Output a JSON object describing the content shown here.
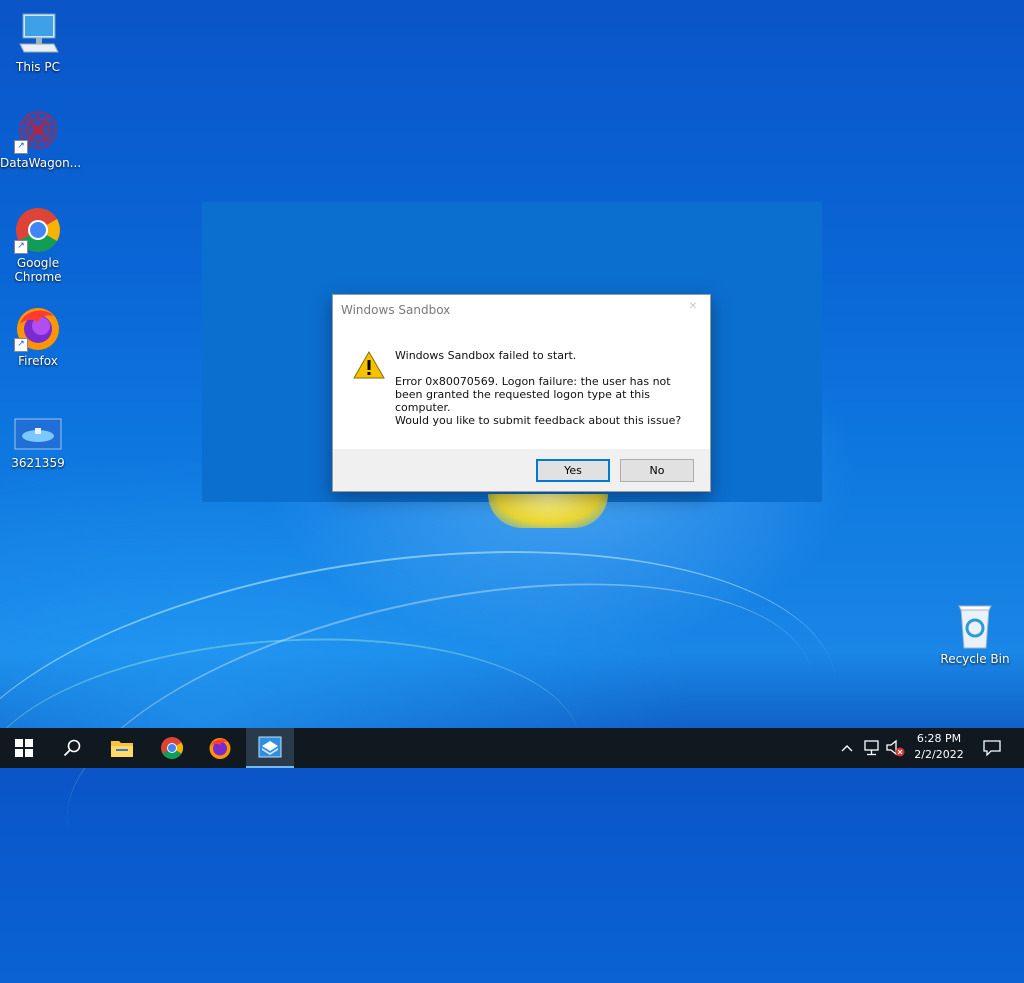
{
  "desktop": {
    "icons": [
      {
        "label": "This PC",
        "icon": "computer-icon"
      },
      {
        "label": "DataWagon...",
        "icon": "datawagon-icon"
      },
      {
        "label": "Google Chrome",
        "icon": "chrome-icon"
      },
      {
        "label": "Firefox",
        "icon": "firefox-icon"
      },
      {
        "label": "3621359",
        "icon": "image-file-icon"
      },
      {
        "label": "Recycle Bin",
        "icon": "recycle-bin-icon"
      }
    ]
  },
  "dialog": {
    "title": "Windows Sandbox",
    "heading": "Windows Sandbox failed to start.",
    "error": "Error 0x80070569. Logon failure: the user has not been granted the requested logon type at this computer.",
    "question": "Would you like to submit feedback about this issue?",
    "yes_label": "Yes",
    "no_label": "No",
    "icon": "warning-icon"
  },
  "taskbar": {
    "items": [
      "start-icon",
      "search-icon",
      "file-explorer-icon",
      "chrome-icon",
      "firefox-icon",
      "windows-sandbox-icon"
    ],
    "tray": {
      "time": "6:28 PM",
      "date": "2/2/2022"
    }
  },
  "colors": {
    "accent": "#0078d7",
    "taskbar": "#101820",
    "desktop": "#0a66d6"
  }
}
